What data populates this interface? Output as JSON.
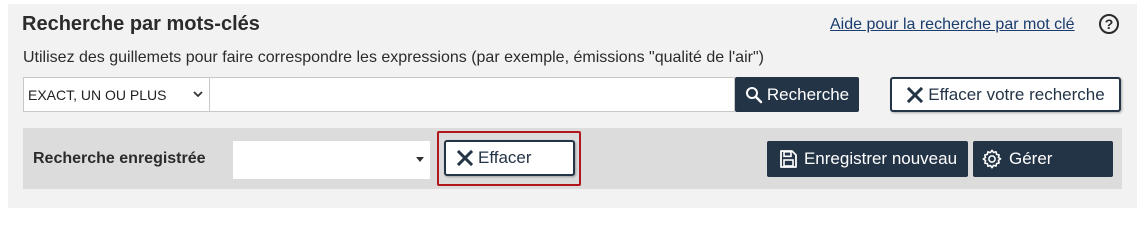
{
  "header": {
    "title": "Recherche par mots-clés",
    "help_link": "Aide pour la recherche par mot clé",
    "help_icon": "help-circle-icon"
  },
  "hint": "Utilisez des guillemets pour faire correspondre les expressions (par exemple, émissions \"qualité de l'air\")",
  "search": {
    "mode_selected": "EXACT, UN OU PLUS",
    "query_value": "",
    "search_label": "Recherche",
    "clear_label": "Effacer votre recherche"
  },
  "saved_search": {
    "label": "Recherche enregistrée",
    "selected_value": "",
    "clear_label": "Effacer",
    "save_new_label": "Enregistrer nouveau",
    "manage_label": "Gérer"
  },
  "colors": {
    "primary_button": "#243447",
    "highlight_border": "#b0171c",
    "panel_bg": "#f2f2f2",
    "saved_bar_bg": "#dcdcdc",
    "link": "#1a3d6d"
  }
}
